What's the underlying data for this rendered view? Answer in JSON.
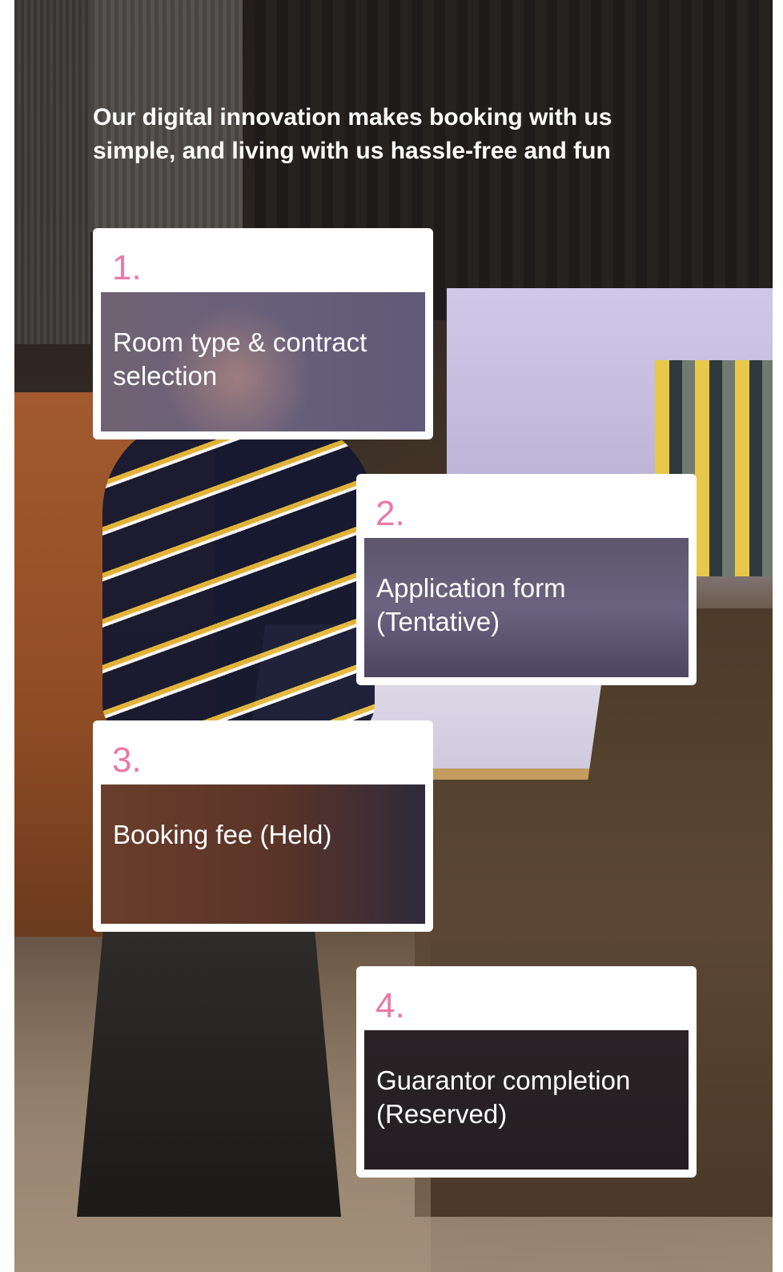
{
  "headline": "Our digital innovation makes booking with us simple, and living with us hassle-free and fun",
  "accent_color": "#e879a8",
  "steps": [
    {
      "number": "1.",
      "label": "Room type & contract selection"
    },
    {
      "number": "2.",
      "label": "Application form (Tentative)"
    },
    {
      "number": "3.",
      "label": "Booking fee (Held)"
    },
    {
      "number": "4.",
      "label": "Guarantor completion (Reserved)"
    }
  ]
}
